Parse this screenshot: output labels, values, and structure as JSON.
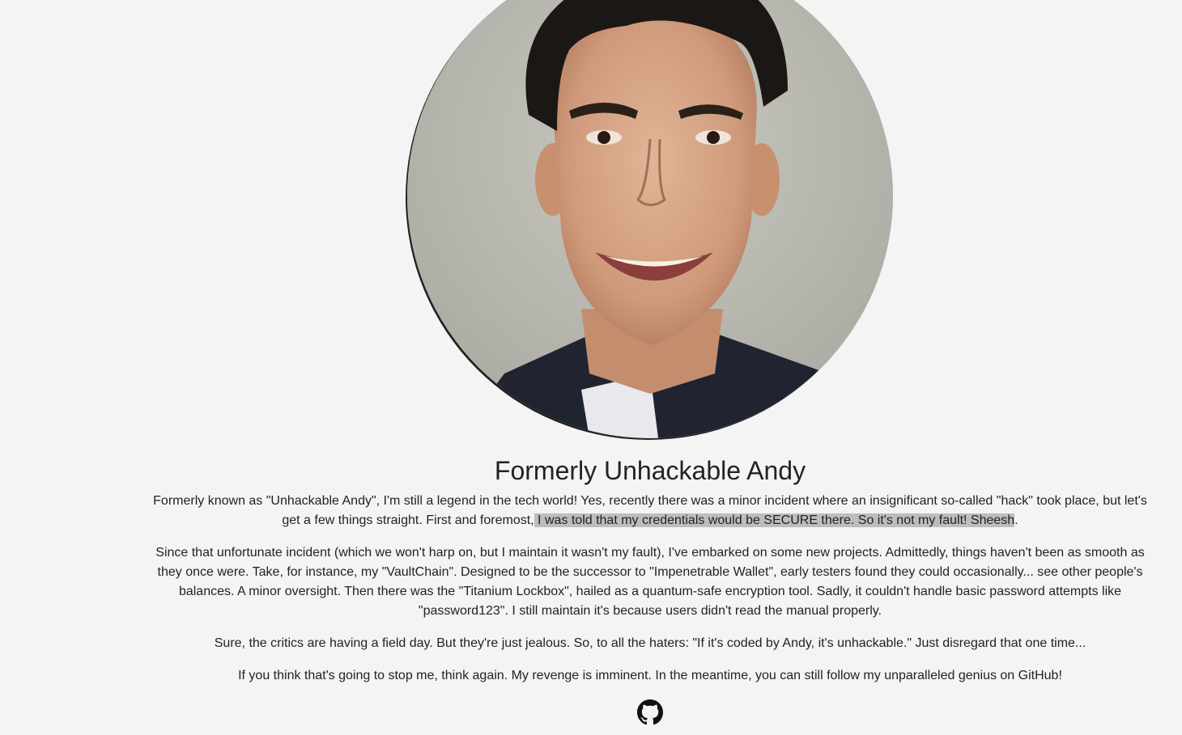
{
  "profile": {
    "photo_icon": "profile-photo",
    "name": "Formerly Unhackable Andy"
  },
  "bio": {
    "p1_before": "Formerly known as \"Unhackable Andy\", I'm still a legend in the tech world! Yes, recently there was a minor incident where an insignificant so-called \"hack\" took place, but let's get a few things straight. First and foremost,",
    "p1_highlight": " I was told that my credentials would be SECURE there. So it's not my fault! Sheesh",
    "p1_after": ".",
    "p2": "Since that unfortunate incident (which we won't harp on, but I maintain it wasn't my fault), I've embarked on some new projects. Admittedly, things haven't been as smooth as they once were. Take, for instance, my \"VaultChain\". Designed to be the successor to \"Impenetrable Wallet\", early testers found they could occasionally... see other people's balances. A minor oversight. Then there was the \"Titanium Lockbox\", hailed as a quantum-safe encryption tool. Sadly, it couldn't handle basic password attempts like \"password123\". I still maintain it's because users didn't read the manual properly.",
    "p3": "Sure, the critics are having a field day. But they're just jealous. So, to all the haters: \"If it's coded by Andy, it's unhackable.\" Just disregard that one time...",
    "p4": "If you think that's going to stop me, think again. My revenge is imminent. In the meantime, you can still follow my unparalleled genius on GitHub!"
  },
  "links": {
    "github_icon": "github-icon"
  },
  "colors": {
    "background": "#f4f4f4",
    "text": "#222222",
    "highlight": "#bdbdbd"
  }
}
